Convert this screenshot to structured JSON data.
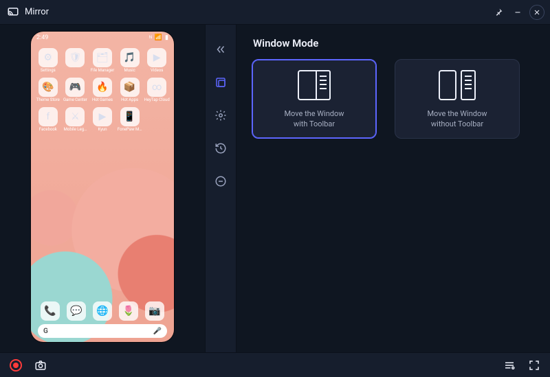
{
  "titlebar": {
    "title": "Mirror"
  },
  "window_controls": {
    "pin": "pin-icon",
    "minimize": "minimize-icon",
    "close": "close-icon"
  },
  "phone": {
    "time": "2:49",
    "status_icons": [
      "nfc",
      "wifi",
      "signal",
      "battery"
    ],
    "apps_row1": [
      {
        "label": "Settings",
        "glyph": "⚙"
      },
      {
        "label": "",
        "glyph": "🛡"
      },
      {
        "label": "File Manager",
        "glyph": "🗂"
      },
      {
        "label": "Music",
        "glyph": "🎵"
      },
      {
        "label": "Videos",
        "glyph": "▶"
      }
    ],
    "apps_row2": [
      {
        "label": "Theme Store",
        "glyph": "🎨"
      },
      {
        "label": "Game Center",
        "glyph": "🎮"
      },
      {
        "label": "Hot Games",
        "glyph": "🔥"
      },
      {
        "label": "Hot Apps",
        "glyph": "📦"
      },
      {
        "label": "HeyTap Cloud",
        "glyph": "∞"
      }
    ],
    "apps_row3": [
      {
        "label": "Facebook",
        "glyph": "f"
      },
      {
        "label": "Mobile Leg…",
        "glyph": "⚔"
      },
      {
        "label": "Kyun",
        "glyph": "▶"
      },
      {
        "label": "FonePaw M…",
        "glyph": "📱"
      },
      {
        "label": "",
        "glyph": ""
      }
    ],
    "dock": [
      {
        "label": "Phone",
        "glyph": "📞"
      },
      {
        "label": "Messages",
        "glyph": "💬"
      },
      {
        "label": "Chrome",
        "glyph": "🌐"
      },
      {
        "label": "Gallery",
        "glyph": "🌷"
      },
      {
        "label": "Camera",
        "glyph": "📷"
      }
    ],
    "search_initial": "G"
  },
  "rail": {
    "items": [
      {
        "id": "collapse",
        "name": "collapse-icon"
      },
      {
        "id": "window-mode",
        "name": "window-mode-icon",
        "active": true
      },
      {
        "id": "settings",
        "name": "gear-icon"
      },
      {
        "id": "history",
        "name": "history-icon"
      },
      {
        "id": "power",
        "name": "power-icon"
      }
    ]
  },
  "main": {
    "heading": "Window Mode",
    "cards": [
      {
        "id": "with-toolbar",
        "line1": "Move the Window",
        "line2": "with Toolbar",
        "selected": true
      },
      {
        "id": "without-toolbar",
        "line1": "Move the Window",
        "line2": "without Toolbar",
        "selected": false
      }
    ]
  },
  "bottombar": {
    "record": "record-button",
    "screenshot": "screenshot-button",
    "list": "device-list-button",
    "fullscreen": "fullscreen-button"
  }
}
